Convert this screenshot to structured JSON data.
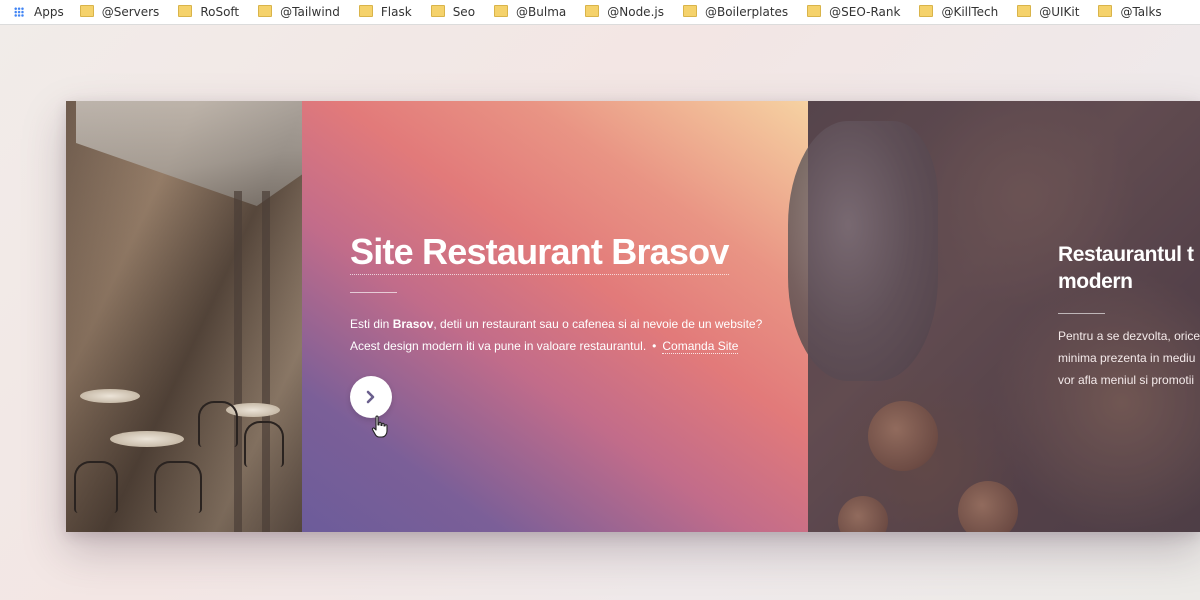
{
  "bookmarks_bar": {
    "apps_label": "Apps",
    "items": [
      "@Servers",
      "RoSoft",
      "@Tailwind",
      "Flask",
      "Seo",
      "@Bulma",
      "@Node.js",
      "@Boilerplates",
      "@SEO-Rank",
      "@KillTech",
      "@UIKit",
      "@Talks"
    ]
  },
  "slide_active": {
    "title": "Site Restaurant Brasov",
    "desc_line1_pre": "Esti din ",
    "desc_line1_bold": "Brasov",
    "desc_line1_post": ", detii un restaurant sau o cafenea si ai nevoie de un website?",
    "desc_line2": "Acest design modern iti va pune in valoare restaurantul.",
    "separator": "•",
    "link_label": "Comanda Site",
    "next_button_icon": "chevron-right-icon"
  },
  "slide_next": {
    "title_line1": "Restaurantul t",
    "title_line2": "modern",
    "desc_line1": "Pentru a se dezvolta, orice",
    "desc_line2": "minima prezenta in mediu",
    "desc_line3": "vor afla meniul si promotii"
  },
  "colors": {
    "gradient_start": "#6c5c9a",
    "gradient_mid": "#e27a7a",
    "gradient_end": "#f6d2a2"
  }
}
